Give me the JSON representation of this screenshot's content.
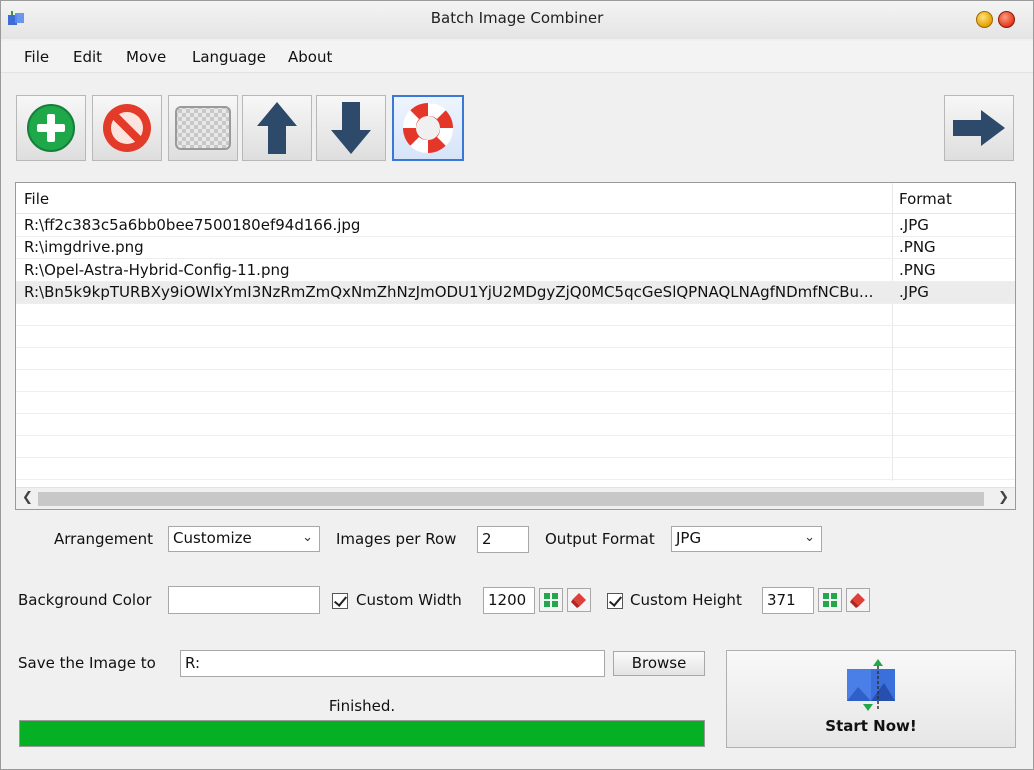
{
  "window": {
    "title": "Batch Image Combiner"
  },
  "menu": [
    "File",
    "Edit",
    "Move",
    "Language",
    "About"
  ],
  "toolbar": {
    "buttons": [
      "add-icon",
      "remove-icon",
      "clear-icon",
      "move-up-icon",
      "move-down-icon",
      "help-icon",
      "next-icon"
    ],
    "active": "help-icon"
  },
  "file_list": {
    "columns": [
      "File",
      "Format"
    ],
    "rows": [
      {
        "file": "R:\\ff2c383c5a6bb0bee7500180ef94d166.jpg",
        "format": ".JPG"
      },
      {
        "file": "R:\\imgdrive.png",
        "format": ".PNG"
      },
      {
        "file": "R:\\Opel-Astra-Hybrid-Config-11.png",
        "format": ".PNG"
      },
      {
        "file": "R:\\Bn5k9kpTURBXy9iOWIxYmI3NzRmZmQxNmZhNzJmODU1YjU2MDgyZjQ0MC5qcGeSlQPNAQLNAgfNDmfNCBu...",
        "format": ".JPG"
      }
    ],
    "selected_row": 3
  },
  "settings": {
    "arrangement_label": "Arrangement",
    "arrangement_value": "Customize",
    "images_per_row_label": "Images per Row",
    "images_per_row_value": "2",
    "output_format_label": "Output Format",
    "output_format_value": "JPG",
    "background_color_label": "Background Color",
    "background_color_value": "#ffffff",
    "custom_width_label": "Custom Width",
    "custom_width_value": "1200",
    "custom_width_checked": true,
    "custom_height_label": "Custom Height",
    "custom_height_value": "371",
    "custom_height_checked": true
  },
  "output": {
    "save_label": "Save the Image to",
    "save_path": "R:",
    "browse_label": "Browse"
  },
  "status": {
    "text": "Finished.",
    "progress_percent": 100,
    "progress_color": "#06b025"
  },
  "start": {
    "label": "Start Now!"
  }
}
